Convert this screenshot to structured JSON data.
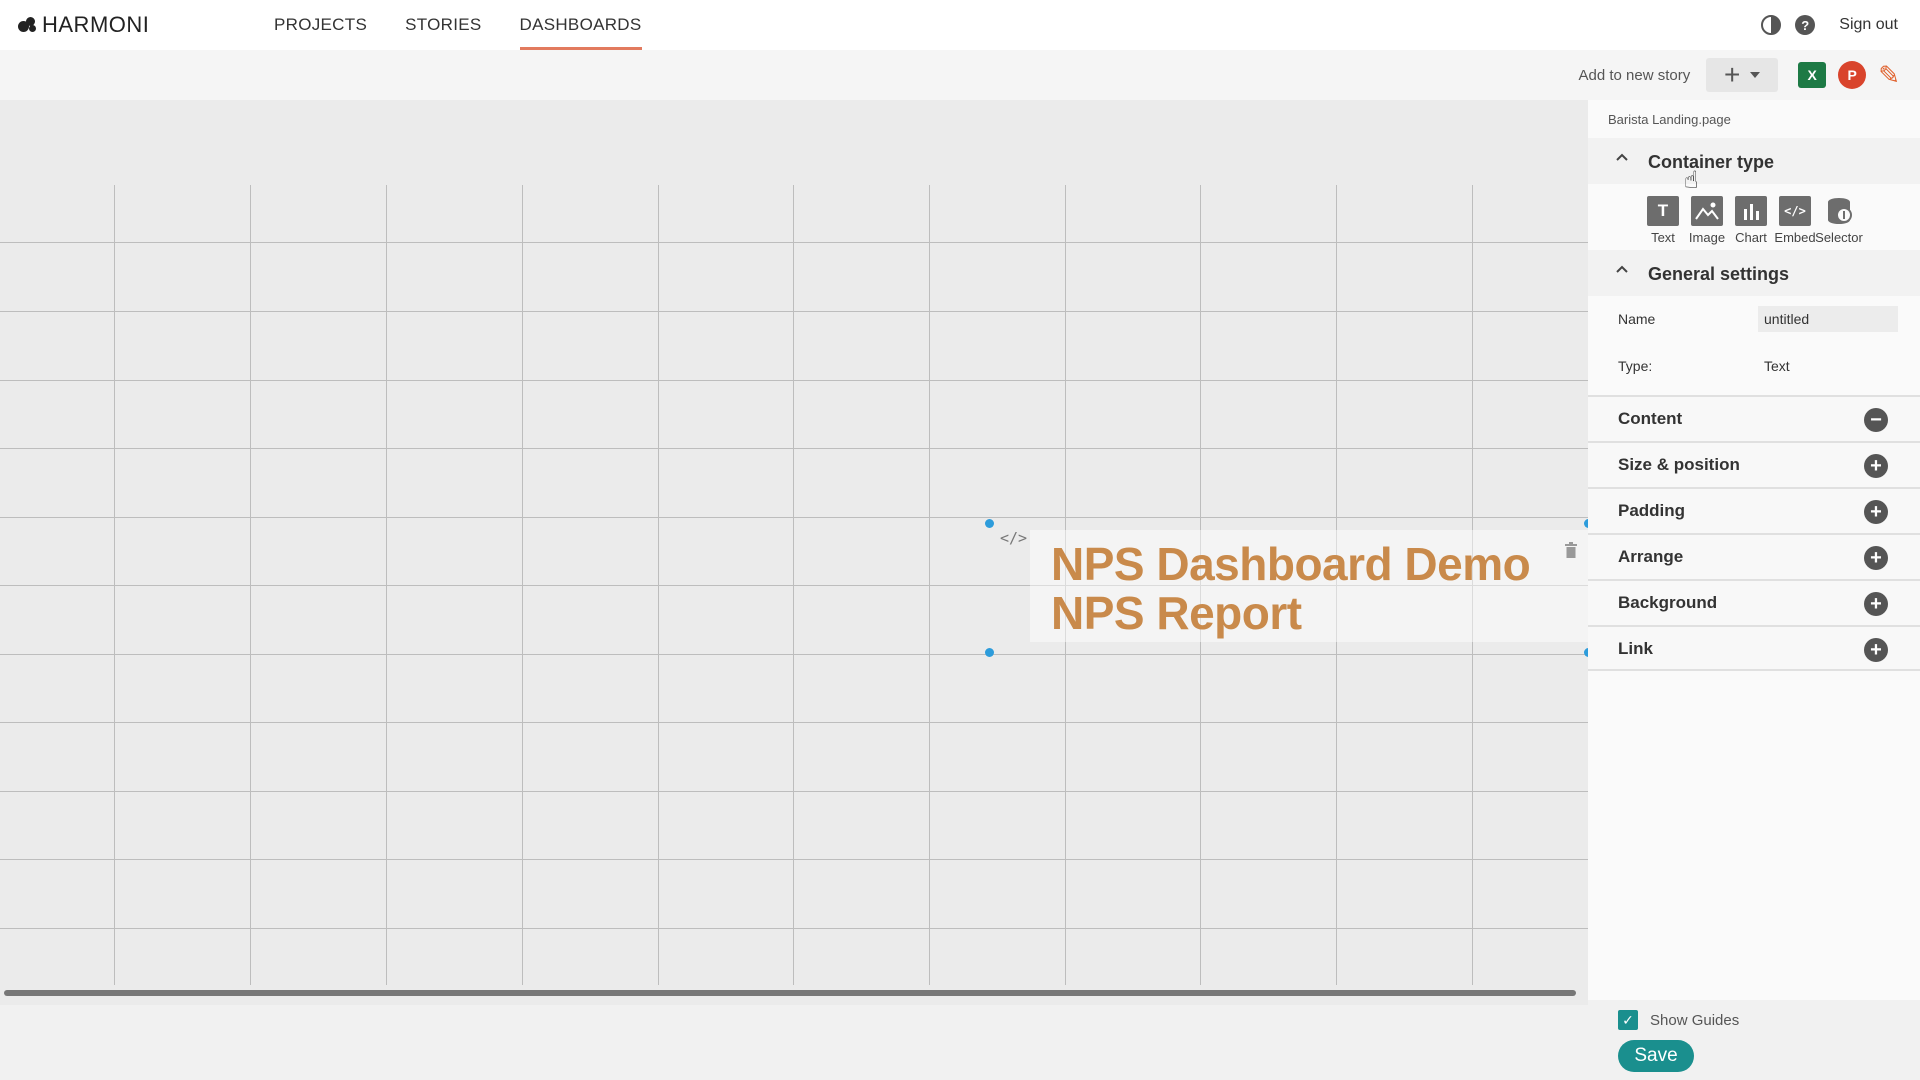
{
  "app": {
    "logo_text": "HARMONI"
  },
  "nav": {
    "items": [
      {
        "label": "PROJECTS",
        "active": false
      },
      {
        "label": "STORIES",
        "active": false
      },
      {
        "label": "DASHBOARDS",
        "active": true
      }
    ],
    "accent_color": "#e27a5e"
  },
  "top_right": {
    "sign_out_label": "Sign out",
    "icons": [
      "contrast-icon",
      "help-icon"
    ]
  },
  "toolbar": {
    "add_to_story_label": "Add to new story",
    "add_icon": "plus-icon",
    "export_icons": [
      "excel-icon",
      "powerpoint-icon"
    ],
    "edit_icon": "pencil-icon",
    "excel_letter": "X",
    "ppt_letter": "P"
  },
  "canvas": {
    "widget": {
      "title_line1": "NPS Dashboard Demo",
      "title_line2": "NPS Report",
      "title_color": "#c98a4b",
      "code_tag": "</>",
      "selection_color": "#2d9cdb"
    }
  },
  "panel": {
    "breadcrumb": "Barista Landing.page",
    "container_type": {
      "heading": "Container type",
      "types": [
        {
          "label": "Text",
          "glyph": "T"
        },
        {
          "label": "Image",
          "glyph": ""
        },
        {
          "label": "Chart",
          "glyph": ""
        },
        {
          "label": "Embed",
          "glyph": "</>"
        },
        {
          "label": "Selector",
          "glyph": ""
        }
      ]
    },
    "general_settings": {
      "heading": "General settings",
      "name_label": "Name",
      "name_value": "untitled",
      "type_label": "Type:",
      "type_value": "Text"
    },
    "sections": [
      {
        "label": "Content",
        "state": "expanded"
      },
      {
        "label": "Size & position",
        "state": "collapsed"
      },
      {
        "label": "Padding",
        "state": "collapsed"
      },
      {
        "label": "Arrange",
        "state": "collapsed"
      },
      {
        "label": "Background",
        "state": "collapsed"
      },
      {
        "label": "Link",
        "state": "collapsed"
      }
    ],
    "show_guides_label": "Show Guides",
    "show_guides_checked": true,
    "save_label": "Save",
    "primary_color": "#1a8f8e"
  }
}
